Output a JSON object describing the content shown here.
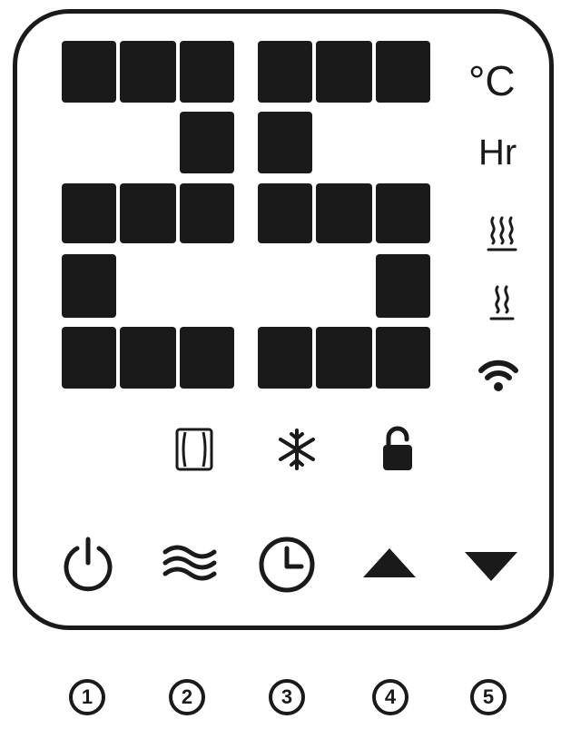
{
  "display": {
    "units": {
      "celsius": "°C",
      "hours": "Hr"
    },
    "indicators": [
      "heat-high-icon",
      "heat-low-icon",
      "wifi-icon",
      "window-open-icon",
      "frost-protection-icon",
      "unlock-icon"
    ]
  },
  "buttons": [
    {
      "icon": "power-icon"
    },
    {
      "icon": "mode-waves-icon"
    },
    {
      "icon": "clock-icon"
    },
    {
      "icon": "arrow-up-icon"
    },
    {
      "icon": "arrow-down-icon"
    }
  ],
  "button_numbers": [
    "1",
    "2",
    "3",
    "4",
    "5"
  ],
  "colors": {
    "ink": "#1a1a1a",
    "background": "#ffffff"
  }
}
